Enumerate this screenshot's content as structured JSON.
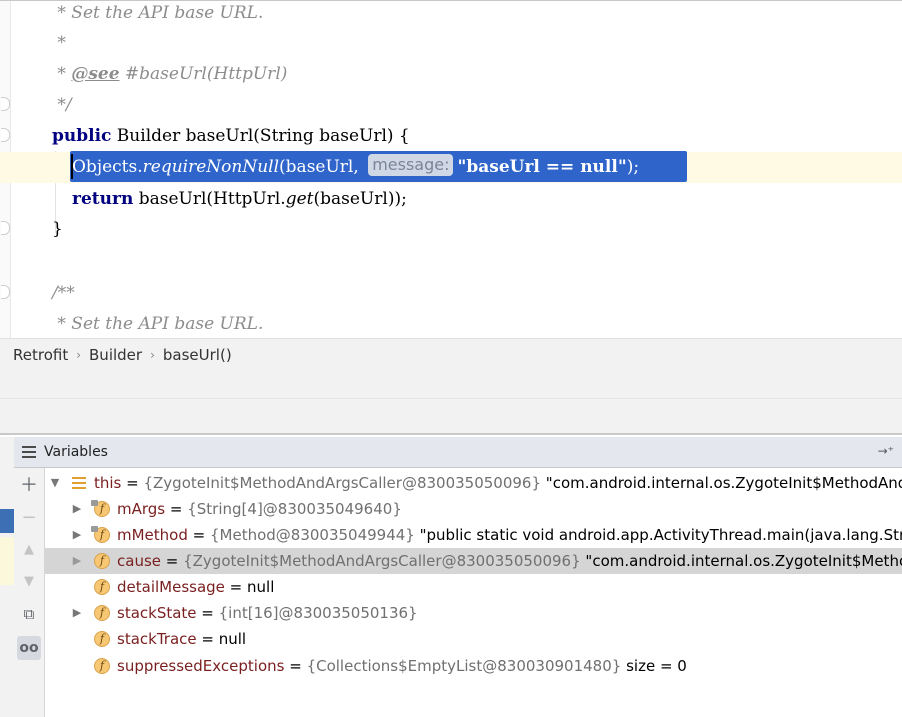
{
  "editor": {
    "lines": [
      {
        "text": " * Set the API base URL."
      },
      {
        "text": " *"
      },
      {
        "text": " * @see #baseUrl(HttpUrl)"
      },
      {
        "text": " */"
      },
      {
        "kw": "public",
        "rest": " Builder baseUrl(String baseUrl) {"
      },
      {
        "pre": "Objects.",
        "method": "requireNonNull",
        "args": "(baseUrl, ",
        "hint": "message:",
        "str": "\"baseUrl == null\"",
        "post": ");"
      },
      {
        "kw": "return",
        "rest": " baseUrl(HttpUrl.",
        "method": "get",
        "post": "(baseUrl));"
      },
      {
        "text": "}"
      },
      {
        "text": "/**"
      },
      {
        "text": " * Set the API base URL."
      }
    ]
  },
  "breadcrumb": [
    "Retrofit",
    "Builder",
    "baseUrl()"
  ],
  "variables_panel": {
    "title": "Variables",
    "toolbar": [
      "+",
      "−",
      "▲",
      "▼",
      "copy",
      "oo"
    ],
    "rows": [
      {
        "name": "this",
        "eq": " = ",
        "ref": "{ZygoteInit$MethodAndArgsCaller@830035050096}",
        "value": " \"com.android.internal.os.ZygoteInit$MethodAndAr",
        "icon": "list-icon"
      },
      {
        "name": "mArgs",
        "eq": " = ",
        "ref": "{String[4]@830035049640}",
        "value": "",
        "icon": "field-icon"
      },
      {
        "name": "mMethod",
        "eq": " = ",
        "ref": "{Method@830035049944}",
        "value": " \"public static void android.app.ActivityThread.main(java.lang.String[",
        "icon": "field-icon"
      },
      {
        "name": "cause",
        "eq": " = ",
        "ref": "{ZygoteInit$MethodAndArgsCaller@830035050096}",
        "value": " \"com.android.internal.os.ZygoteInit$MethodA",
        "icon": "field-icon"
      },
      {
        "name": "detailMessage",
        "eq": " = ",
        "ref": "",
        "value": "null",
        "icon": "field-icon"
      },
      {
        "name": "stackState",
        "eq": " = ",
        "ref": "{int[16]@830035050136}",
        "value": "",
        "icon": "field-icon"
      },
      {
        "name": "stackTrace",
        "eq": " = ",
        "ref": "",
        "value": "null",
        "icon": "field-icon"
      },
      {
        "name": "suppressedExceptions",
        "eq": " = ",
        "ref": "{Collections$EmptyList@830030901480}",
        "value": " size = 0",
        "icon": "field-icon"
      }
    ]
  },
  "colors": {
    "selection": "#2f65ca",
    "current_line": "#fffae3",
    "keyword": "#000080",
    "comment": "#8c8c8c"
  }
}
